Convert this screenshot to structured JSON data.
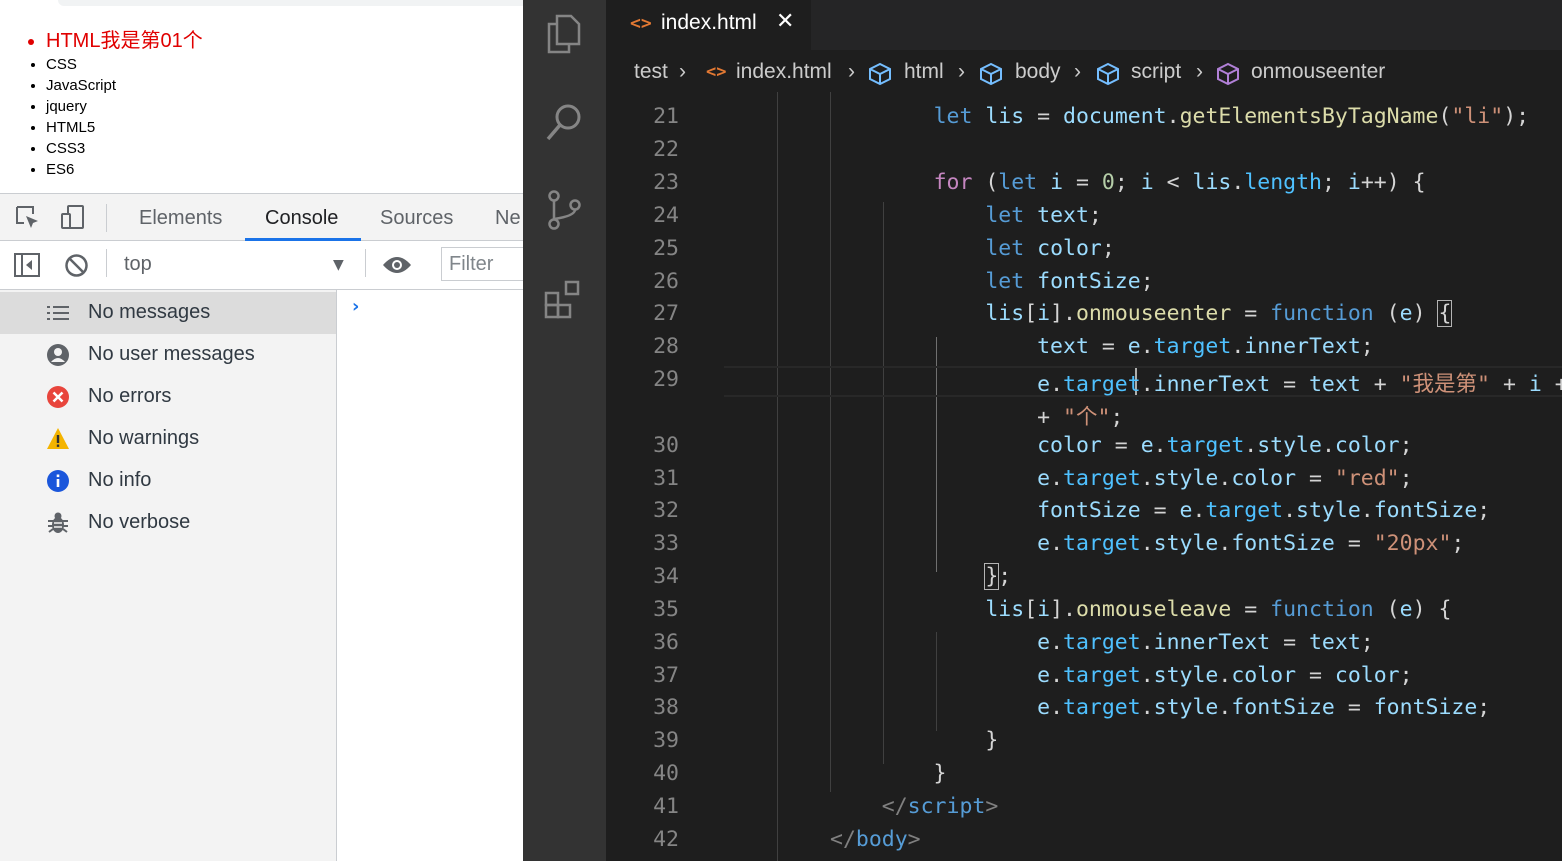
{
  "browser_page": {
    "list_items": [
      "HTML我是第01个",
      "CSS",
      "JavaScript",
      "jquery",
      "HTML5",
      "CSS3",
      "ES6"
    ]
  },
  "devtools": {
    "tabs": [
      {
        "label": "Elements",
        "active": false
      },
      {
        "label": "Console",
        "active": true
      },
      {
        "label": "Sources",
        "active": false
      },
      {
        "label": "Ne",
        "active": false
      }
    ],
    "context": "top",
    "filter_placeholder": "Filter",
    "sidebar": [
      {
        "label": "No messages",
        "icon": "list-icon",
        "selected": true
      },
      {
        "label": "No user messages",
        "icon": "user-icon",
        "selected": false
      },
      {
        "label": "No errors",
        "icon": "error-icon",
        "selected": false
      },
      {
        "label": "No warnings",
        "icon": "warning-icon",
        "selected": false
      },
      {
        "label": "No info",
        "icon": "info-icon",
        "selected": false
      },
      {
        "label": "No verbose",
        "icon": "bug-icon",
        "selected": false
      }
    ],
    "prompt": "›"
  },
  "vscode": {
    "tab": {
      "icon": "<>",
      "filename": "index.html",
      "close": "✕"
    },
    "breadcrumb": [
      {
        "label": "test",
        "icon": "none"
      },
      {
        "label": "index.html",
        "icon": "html-file-icon"
      },
      {
        "label": "html",
        "icon": "element-icon"
      },
      {
        "label": "body",
        "icon": "element-icon"
      },
      {
        "label": "script",
        "icon": "element-icon"
      },
      {
        "label": "onmouseenter",
        "icon": "method-icon"
      }
    ],
    "line_numbers": [
      "21",
      "22",
      "23",
      "24",
      "25",
      "26",
      "27",
      "28",
      "29",
      "",
      "30",
      "31",
      "32",
      "33",
      "34",
      "35",
      "36",
      "37",
      "38",
      "39",
      "40",
      "41",
      "42"
    ],
    "colors": {
      "keyword": "#569cd6",
      "control": "#c586c0",
      "variable": "#9cdcfe",
      "function": "#dcdcaa",
      "string": "#ce9178",
      "number": "#b5cea8",
      "property": "#4fc1ff"
    }
  }
}
